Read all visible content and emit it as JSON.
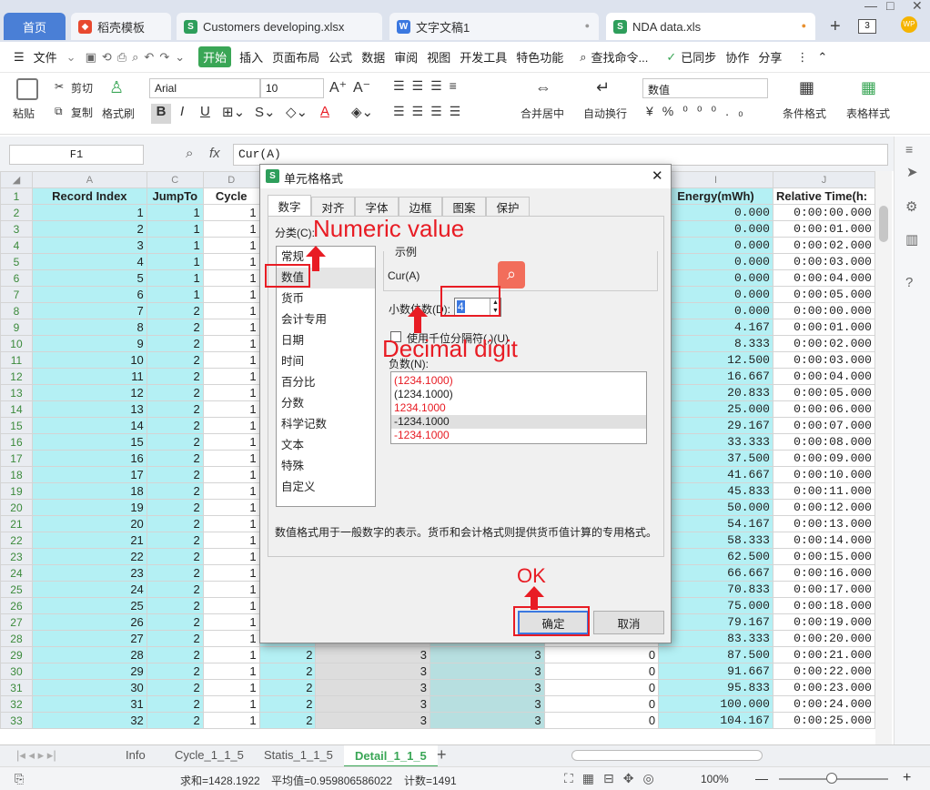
{
  "tabs": {
    "home": "首页",
    "items": [
      {
        "label": "稻壳模板",
        "icon": "docer-icon"
      },
      {
        "label": "Customers developing.xlsx",
        "icon": "spreadsheet-icon"
      },
      {
        "label": "文字文稿1",
        "icon": "writer-icon"
      },
      {
        "label": "NDA data.xls",
        "icon": "spreadsheet-icon"
      }
    ],
    "count": "3"
  },
  "menu": {
    "file": "文件",
    "items": [
      "开始",
      "插入",
      "页面布局",
      "公式",
      "数据",
      "审阅",
      "视图",
      "开发工具",
      "特色功能"
    ],
    "search": "查找命令...",
    "sync": "已同步",
    "collab": "协作",
    "share": "分享"
  },
  "ribbon": {
    "paste": "粘贴",
    "cut": "剪切",
    "copy": "复制",
    "format_painter": "格式刷",
    "font": "Arial",
    "size": "10",
    "merge": "合并居中",
    "wrap": "自动换行",
    "numfmt": "数值",
    "cond_fmt": "条件格式",
    "table_style": "表格样式"
  },
  "formula": {
    "cell_ref": "F1",
    "fx": "fx",
    "value": "Cur(A)"
  },
  "grid": {
    "col_letters": [
      "A",
      "C",
      "D",
      "I",
      "J"
    ],
    "headers": [
      "Record Index",
      "JumpTo",
      "Cycle",
      "Energy(mWh)",
      "Relative Time(h:"
    ],
    "rows": [
      {
        "r": "2",
        "a": "1",
        "c": "1",
        "d": "1",
        "i": "0.000",
        "j": "0:00:00.000"
      },
      {
        "r": "3",
        "a": "2",
        "c": "1",
        "d": "1",
        "i": "0.000",
        "j": "0:00:01.000"
      },
      {
        "r": "4",
        "a": "3",
        "c": "1",
        "d": "1",
        "i": "0.000",
        "j": "0:00:02.000"
      },
      {
        "r": "5",
        "a": "4",
        "c": "1",
        "d": "1",
        "i": "0.000",
        "j": "0:00:03.000"
      },
      {
        "r": "6",
        "a": "5",
        "c": "1",
        "d": "1",
        "i": "0.000",
        "j": "0:00:04.000"
      },
      {
        "r": "7",
        "a": "6",
        "c": "1",
        "d": "1",
        "i": "0.000",
        "j": "0:00:05.000"
      },
      {
        "r": "8",
        "a": "7",
        "c": "2",
        "d": "1",
        "i": "0.000",
        "j": "0:00:00.000"
      },
      {
        "r": "9",
        "a": "8",
        "c": "2",
        "d": "1",
        "i": "4.167",
        "j": "0:00:01.000"
      },
      {
        "r": "10",
        "a": "9",
        "c": "2",
        "d": "1",
        "i": "8.333",
        "j": "0:00:02.000"
      },
      {
        "r": "11",
        "a": "10",
        "c": "2",
        "d": "1",
        "i": "12.500",
        "j": "0:00:03.000"
      },
      {
        "r": "12",
        "a": "11",
        "c": "2",
        "d": "1",
        "i": "16.667",
        "j": "0:00:04.000"
      },
      {
        "r": "13",
        "a": "12",
        "c": "2",
        "d": "1",
        "i": "20.833",
        "j": "0:00:05.000"
      },
      {
        "r": "14",
        "a": "13",
        "c": "2",
        "d": "1",
        "i": "25.000",
        "j": "0:00:06.000"
      },
      {
        "r": "15",
        "a": "14",
        "c": "2",
        "d": "1",
        "i": "29.167",
        "j": "0:00:07.000"
      },
      {
        "r": "16",
        "a": "15",
        "c": "2",
        "d": "1",
        "i": "33.333",
        "j": "0:00:08.000"
      },
      {
        "r": "17",
        "a": "16",
        "c": "2",
        "d": "1",
        "i": "37.500",
        "j": "0:00:09.000"
      },
      {
        "r": "18",
        "a": "17",
        "c": "2",
        "d": "1",
        "i": "41.667",
        "j": "0:00:10.000"
      },
      {
        "r": "19",
        "a": "18",
        "c": "2",
        "d": "1",
        "i": "45.833",
        "j": "0:00:11.000"
      },
      {
        "r": "20",
        "a": "19",
        "c": "2",
        "d": "1",
        "i": "50.000",
        "j": "0:00:12.000"
      },
      {
        "r": "21",
        "a": "20",
        "c": "2",
        "d": "1",
        "i": "54.167",
        "j": "0:00:13.000"
      },
      {
        "r": "22",
        "a": "21",
        "c": "2",
        "d": "1",
        "i": "58.333",
        "j": "0:00:14.000"
      },
      {
        "r": "23",
        "a": "22",
        "c": "2",
        "d": "1",
        "i": "62.500",
        "j": "0:00:15.000"
      },
      {
        "r": "24",
        "a": "23",
        "c": "2",
        "d": "1",
        "i": "66.667",
        "j": "0:00:16.000"
      },
      {
        "r": "25",
        "a": "24",
        "c": "2",
        "d": "1",
        "i": "70.833",
        "j": "0:00:17.000"
      },
      {
        "r": "26",
        "a": "25",
        "c": "2",
        "d": "1",
        "i": "75.000",
        "j": "0:00:18.000"
      },
      {
        "r": "27",
        "a": "26",
        "c": "2",
        "d": "1",
        "i": "79.167",
        "j": "0:00:19.000"
      },
      {
        "r": "28",
        "a": "27",
        "c": "2",
        "d": "1",
        "e": "2",
        "f": "3",
        "g": "3",
        "h": "0",
        "i": "83.333",
        "j": "0:00:20.000"
      },
      {
        "r": "29",
        "a": "28",
        "c": "2",
        "d": "1",
        "e": "2",
        "f": "3",
        "g": "3",
        "h": "0",
        "i": "87.500",
        "j": "0:00:21.000"
      },
      {
        "r": "30",
        "a": "29",
        "c": "2",
        "d": "1",
        "e": "2",
        "f": "3",
        "g": "3",
        "h": "0",
        "i": "91.667",
        "j": "0:00:22.000"
      },
      {
        "r": "31",
        "a": "30",
        "c": "2",
        "d": "1",
        "e": "2",
        "f": "3",
        "g": "3",
        "h": "0",
        "i": "95.833",
        "j": "0:00:23.000"
      },
      {
        "r": "32",
        "a": "31",
        "c": "2",
        "d": "1",
        "e": "2",
        "f": "3",
        "g": "3",
        "h": "0",
        "i": "100.000",
        "j": "0:00:24.000"
      },
      {
        "r": "33",
        "a": "32",
        "c": "2",
        "d": "1",
        "e": "2",
        "f": "3",
        "g": "3",
        "h": "0",
        "i": "104.167",
        "j": "0:00:25.000"
      }
    ]
  },
  "sheets": [
    "Info",
    "Cycle_1_1_5",
    "Statis_1_1_5",
    "Detail_1_1_5"
  ],
  "status": {
    "sum": "求和=1428.1922",
    "avg": "平均值=0.959806586022",
    "count": "计数=1491",
    "zoom": "100%"
  },
  "dialog": {
    "title": "单元格格式",
    "tabs": [
      "数字",
      "对齐",
      "字体",
      "边框",
      "图案",
      "保护"
    ],
    "category_label": "分类(C):",
    "categories": [
      "常规",
      "数值",
      "货币",
      "会计专用",
      "日期",
      "时间",
      "百分比",
      "分数",
      "科学记数",
      "文本",
      "特殊",
      "自定义"
    ],
    "sample_label": "示例",
    "sample_value": "Cur(A)",
    "decimal_label": "小数位数(D):",
    "decimal_value": "4",
    "thousands_label": "使用千位分隔符(,)(U)",
    "negative_label": "负数(N):",
    "negatives": [
      "(1234.1000)",
      "(1234.1000)",
      "1234.1000",
      "-1234.1000",
      "-1234.1000"
    ],
    "description": "数值格式用于一般数字的表示。货币和会计格式则提供货币值计算的专用格式。",
    "ok": "确定",
    "cancel": "取消"
  },
  "annotations": {
    "numeric": "Numeric value",
    "decimal": "Decimal digit",
    "ok": "OK"
  },
  "colors": {
    "accent_green": "#3aa656",
    "annotation_red": "#e81c24",
    "cyan": "#b4f0f4"
  }
}
